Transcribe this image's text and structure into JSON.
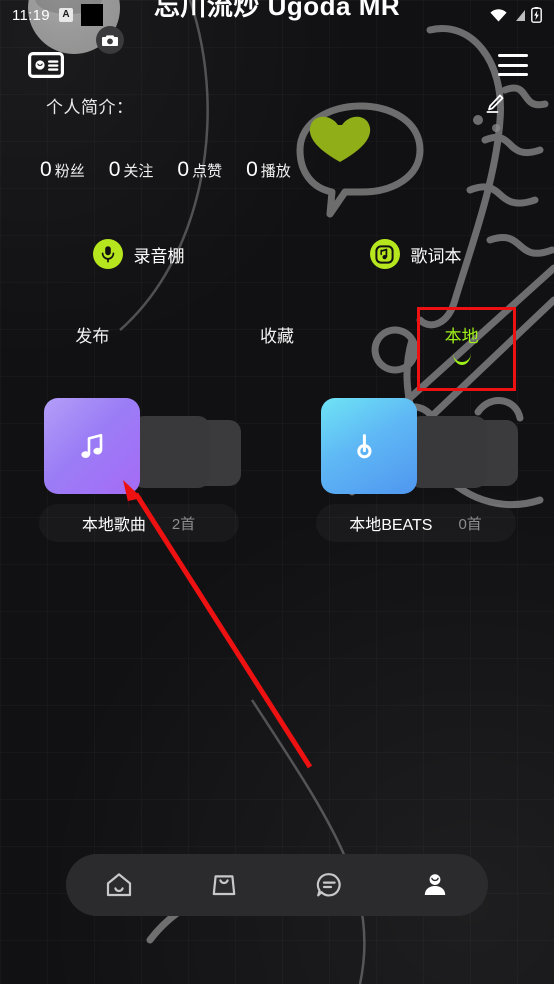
{
  "status_bar": {
    "time": "11:19",
    "badge_letter": "A",
    "icons": [
      "notification-redacted",
      "wifi-icon",
      "signal-icon",
      "battery-charging-icon"
    ]
  },
  "header": {
    "username": "忘川流炒  Ugoda MR",
    "avatar_alt": "user-avatar",
    "camera_button": "change-avatar",
    "id_badge_button": "profile-card",
    "menu_button": "menu",
    "edit_button": "edit-profile",
    "bio_label": "个人简介："
  },
  "stats": [
    {
      "value": "0",
      "label": "粉丝"
    },
    {
      "value": "0",
      "label": "关注"
    },
    {
      "value": "0",
      "label": "点赞"
    },
    {
      "value": "0",
      "label": "播放"
    }
  ],
  "quick_actions": [
    {
      "label": "录音棚",
      "icon": "microphone-icon"
    },
    {
      "label": "歌词本",
      "icon": "lyrics-note-icon"
    }
  ],
  "tabs": [
    {
      "label": "发布",
      "active": false
    },
    {
      "label": "收藏",
      "active": false
    },
    {
      "label": "本地",
      "active": true
    }
  ],
  "folders": [
    {
      "name": "本地歌曲",
      "count": "2首",
      "icon": "music-note-icon",
      "theme": "purple"
    },
    {
      "name": "本地BEATS",
      "count": "0首",
      "icon": "beats-b-icon",
      "theme": "blue"
    }
  ],
  "bottom_nav": [
    {
      "name": "home",
      "icon": "home-icon",
      "active": false
    },
    {
      "name": "shop",
      "icon": "bag-icon",
      "active": false
    },
    {
      "name": "messages",
      "icon": "chat-icon",
      "active": false
    },
    {
      "name": "profile",
      "icon": "person-icon",
      "active": true
    }
  ],
  "annotations": {
    "highlight_box": "本地",
    "arrow_target": "本地歌曲",
    "color": "#ee1111"
  },
  "colors": {
    "accent_green": "#b6e61e",
    "tab_active_green": "#9ef01a",
    "background": "#111113",
    "nav_background": "#2b2b2e",
    "annotation_red": "#ee1111"
  }
}
